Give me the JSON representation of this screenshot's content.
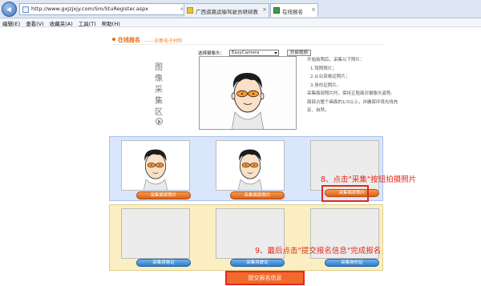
{
  "browser": {
    "url": "http://www.gxjzjxjy.com/Sm/StuRegister.aspx",
    "tabs": [
      {
        "label": "广西道路运输驾驶员继续教育..."
      },
      {
        "label": "在线报名"
      }
    ],
    "close_glyph": "×",
    "menu": [
      "编辑(E)",
      "查看(V)",
      "收藏夹(A)",
      "工具(T)",
      "帮助(H)"
    ]
  },
  "page": {
    "title": "在线报名",
    "subtitle": "——采集电子材料",
    "side_label": [
      "图",
      "像",
      "采",
      "集",
      "区"
    ],
    "device_label": "选择摄像头：",
    "device_value": "EasyCamera",
    "open_camera_button": "开启视频",
    "instructions": [
      "开始拍照后，采集以下照片：",
      "1.驾照照片；",
      "2.从业资格证照片；",
      "3.身份证照片。",
      "采集面部照片时，保持正脸面对摄像头姿势、",
      "面部占整个画面的1/3以上，并确保环境光线充",
      "足、自然。"
    ],
    "capture_buttons": [
      "采集面部照片",
      "采集面部照片",
      "采集面部照片"
    ],
    "document_buttons": [
      "采集资格证",
      "采集驾驶证",
      "采集身份证"
    ],
    "submit_button": "提交报名信息"
  },
  "annotations": {
    "step8": "8、点击\"采集\"按钮拍摄照片",
    "step9": "9、最后点击\"提交报名信息\"完成报名"
  },
  "colors": {
    "accent": "#e8690c",
    "annotation": "#e2291c",
    "blue_panel": "#d9e6fb",
    "yellow_panel": "#faeec2"
  },
  "icons": [
    "back-arrow-icon",
    "page-icon",
    "search-icon",
    "refresh-icon",
    "close-icon",
    "orange-dot-icon",
    "arrow-right-icon"
  ]
}
